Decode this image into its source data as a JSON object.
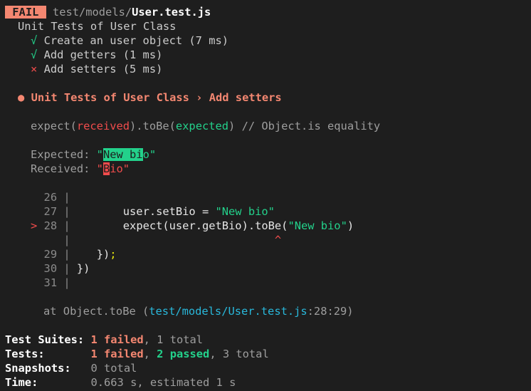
{
  "header": {
    "badge": "FAIL",
    "path_prefix": "test/models/",
    "file_name": "User.test.js"
  },
  "suite": {
    "title": "Unit Tests of User Class",
    "tests": [
      {
        "mark": "√",
        "label": "Create an user object (7 ms)"
      },
      {
        "mark": "√",
        "label": "Add getters (1 ms)"
      },
      {
        "mark": "×",
        "label": "Add setters (5 ms)"
      }
    ]
  },
  "failure": {
    "bullet": "●",
    "title": "Unit Tests of User Class › Add setters",
    "expect": {
      "prefix": "expect(",
      "received": "received",
      "mid": ").toBe(",
      "expected": "expected",
      "suffix": ") // Object.is equality"
    },
    "expected_label": "Expected: ",
    "expected_q1": "\"",
    "expected_hl": "New bi",
    "expected_rest": "o\"",
    "received_label": "Received: ",
    "received_q1": "\"",
    "received_hl": "B",
    "received_rest": "io\""
  },
  "code": {
    "pointer": ">",
    "caret": "^",
    "lines": [
      {
        "num": "26",
        "text": ""
      },
      {
        "num": "27",
        "a": "        user.setBio = ",
        "s": "\"New bio\""
      },
      {
        "num": "28",
        "a": "        expect(user.getBio).toBe(",
        "s": "\"New bio\"",
        "b": ")"
      },
      {
        "num": "",
        "text": ""
      },
      {
        "num": "29",
        "a": "    })",
        "y": ";"
      },
      {
        "num": "30",
        "text": "})"
      },
      {
        "num": "31",
        "text": ""
      }
    ]
  },
  "location": {
    "prefix": "at Object.toBe (",
    "path": "test/models/User.test.js",
    "pos": ":28:29)"
  },
  "summary": {
    "suites_label": "Test Suites:",
    "suites_failed": "1 failed",
    "suites_total": ", 1 total",
    "tests_label": "Tests:",
    "tests_failed": "1 failed",
    "tests_sep": ", ",
    "tests_passed": "2 passed",
    "tests_total": ", 3 total",
    "snapshots_label": "Snapshots:",
    "snapshots_value": "0 total",
    "time_label": "Time:",
    "time_value": "0.663 s, estimated 1 s"
  },
  "colors": {
    "background": "#1e1e1e",
    "pass": "#23d18b",
    "fail": "#f14c4c",
    "fail_title": "#f48771",
    "path": "#29b8db"
  }
}
